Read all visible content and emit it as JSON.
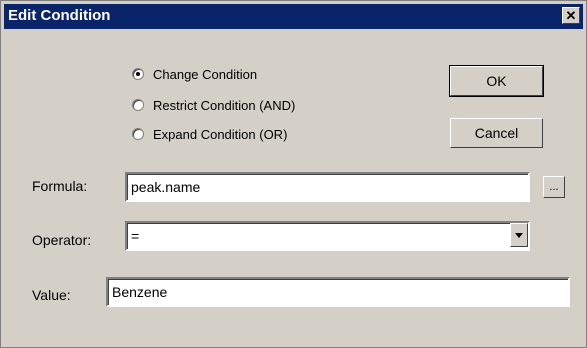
{
  "window": {
    "title": "Edit Condition",
    "close_glyph": "✕"
  },
  "radios": [
    {
      "label": "Change Condition",
      "checked": true
    },
    {
      "label": "Restrict Condition (AND)",
      "checked": false
    },
    {
      "label": "Expand Condition (OR)",
      "checked": false
    }
  ],
  "buttons": {
    "ok": "OK",
    "cancel": "Cancel",
    "browse": "..."
  },
  "form": {
    "formula_label": "Formula:",
    "formula_value": "peak.name",
    "operator_label": "Operator:",
    "operator_value": "=",
    "value_label": "Value:",
    "value_value": "Benzene"
  },
  "icons": {
    "close": "close-icon",
    "dropdown": "chevron-down-icon",
    "radio": "radio-icon"
  }
}
